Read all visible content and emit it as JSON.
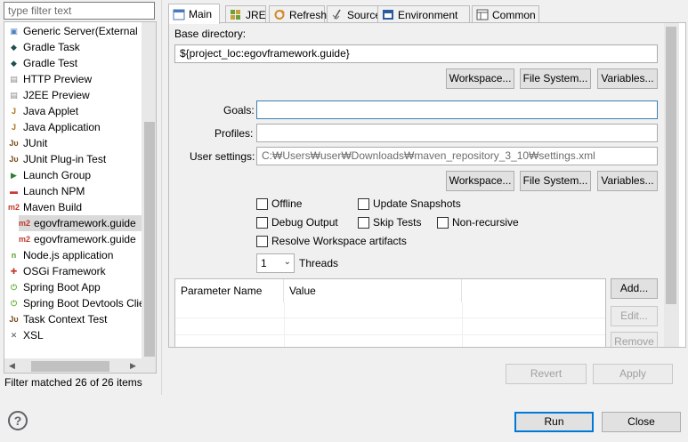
{
  "filter": {
    "placeholder": "type filter text",
    "status": "Filter matched 26 of 26 items"
  },
  "tree": {
    "items": [
      {
        "label": "Generic Server(External L",
        "icon": "server-icon"
      },
      {
        "label": "Gradle Task",
        "icon": "gradle-icon"
      },
      {
        "label": "Gradle Test",
        "icon": "gradle-icon"
      },
      {
        "label": "HTTP Preview",
        "icon": "file-icon"
      },
      {
        "label": "J2EE Preview",
        "icon": "file-icon"
      },
      {
        "label": "Java Applet",
        "icon": "java-applet-icon"
      },
      {
        "label": "Java Application",
        "icon": "java-application-icon"
      },
      {
        "label": "JUnit",
        "icon": "junit-icon"
      },
      {
        "label": "JUnit Plug-in Test",
        "icon": "junit-plugin-icon"
      },
      {
        "label": "Launch Group",
        "icon": "launch-group-icon"
      },
      {
        "label": "Launch NPM",
        "icon": "npm-icon"
      },
      {
        "label": "Maven Build",
        "icon": "maven-icon"
      },
      {
        "label": "egovframework.guide",
        "icon": "maven-icon",
        "child": true,
        "selected": true
      },
      {
        "label": "egovframework.guide",
        "icon": "maven-icon",
        "child": true
      },
      {
        "label": "Node.js application",
        "icon": "nodejs-icon"
      },
      {
        "label": "OSGi Framework",
        "icon": "osgi-icon"
      },
      {
        "label": "Spring Boot App",
        "icon": "spring-boot-icon"
      },
      {
        "label": "Spring Boot Devtools Clie",
        "icon": "spring-devtools-icon"
      },
      {
        "label": "Task Context Test",
        "icon": "task-context-icon"
      },
      {
        "label": "XSL",
        "icon": "xsl-icon"
      }
    ]
  },
  "tabs": [
    {
      "label": "Main",
      "icon": "main-icon",
      "active": true
    },
    {
      "label": "JRE",
      "icon": "jre-icon"
    },
    {
      "label": "Refresh",
      "icon": "refresh-icon"
    },
    {
      "label": "Source",
      "icon": "source-icon"
    },
    {
      "label": "Environment",
      "icon": "environment-icon"
    },
    {
      "label": "Common",
      "icon": "common-icon"
    }
  ],
  "main": {
    "base_directory_label": "Base directory:",
    "base_directory_value": "${project_loc:egovframework.guide}",
    "buttons1": {
      "workspace": "Workspace...",
      "file_system": "File System...",
      "variables": "Variables..."
    },
    "goals_label": "Goals:",
    "goals_value": "",
    "profiles_label": "Profiles:",
    "profiles_value": "",
    "user_settings_label": "User settings:",
    "user_settings_value": "C:₩Users₩user₩Downloads₩maven_repository_3_10₩settings.xml",
    "buttons2": {
      "workspace": "Workspace...",
      "file_system": "File System...",
      "variables": "Variables..."
    },
    "checks": {
      "offline": "Offline",
      "update_snapshots": "Update Snapshots",
      "debug_output": "Debug Output",
      "skip_tests": "Skip Tests",
      "non_recursive": "Non-recursive",
      "resolve_workspace": "Resolve Workspace artifacts"
    },
    "threads_value": "1",
    "threads_label": "Threads",
    "param_table": {
      "col_name": "Parameter Name",
      "col_value": "Value"
    },
    "param_buttons": {
      "add": "Add...",
      "edit": "Edit...",
      "remove": "Remove"
    }
  },
  "actions": {
    "revert": "Revert",
    "apply": "Apply",
    "run": "Run",
    "close": "Close"
  },
  "help": {
    "symbol": "?"
  }
}
